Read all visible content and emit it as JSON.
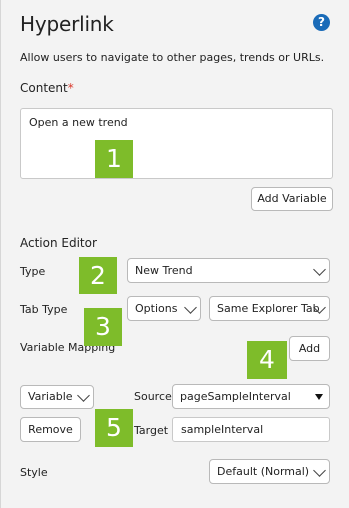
{
  "header": {
    "title": "Hyperlink",
    "help_icon": "?"
  },
  "description": "Allow users to navigate to other pages, trends or URLs.",
  "content": {
    "label": "Content",
    "required_mark": "*",
    "value": "Open a new trend",
    "add_variable_label": "Add Variable"
  },
  "action_editor": {
    "heading": "Action Editor",
    "type_label": "Type",
    "type_value": "New Trend",
    "tab_type_label": "Tab Type",
    "tab_type_value": "Options",
    "tab_target_value": "Same Explorer Tab",
    "variable_mapping_label": "Variable Mapping",
    "add_label": "Add",
    "mapping": {
      "kind_value": "Variable",
      "remove_label": "Remove",
      "source_label": "Source",
      "source_value": "pageSampleInterval",
      "target_label": "Target",
      "target_value": "sampleInterval"
    },
    "style_label": "Style",
    "style_value": "Default (Normal)"
  },
  "callouts": [
    "1",
    "2",
    "3",
    "4",
    "5"
  ],
  "colors": {
    "callout": "#7ebc2a",
    "help": "#1a6bb8",
    "required": "#d9382b"
  }
}
